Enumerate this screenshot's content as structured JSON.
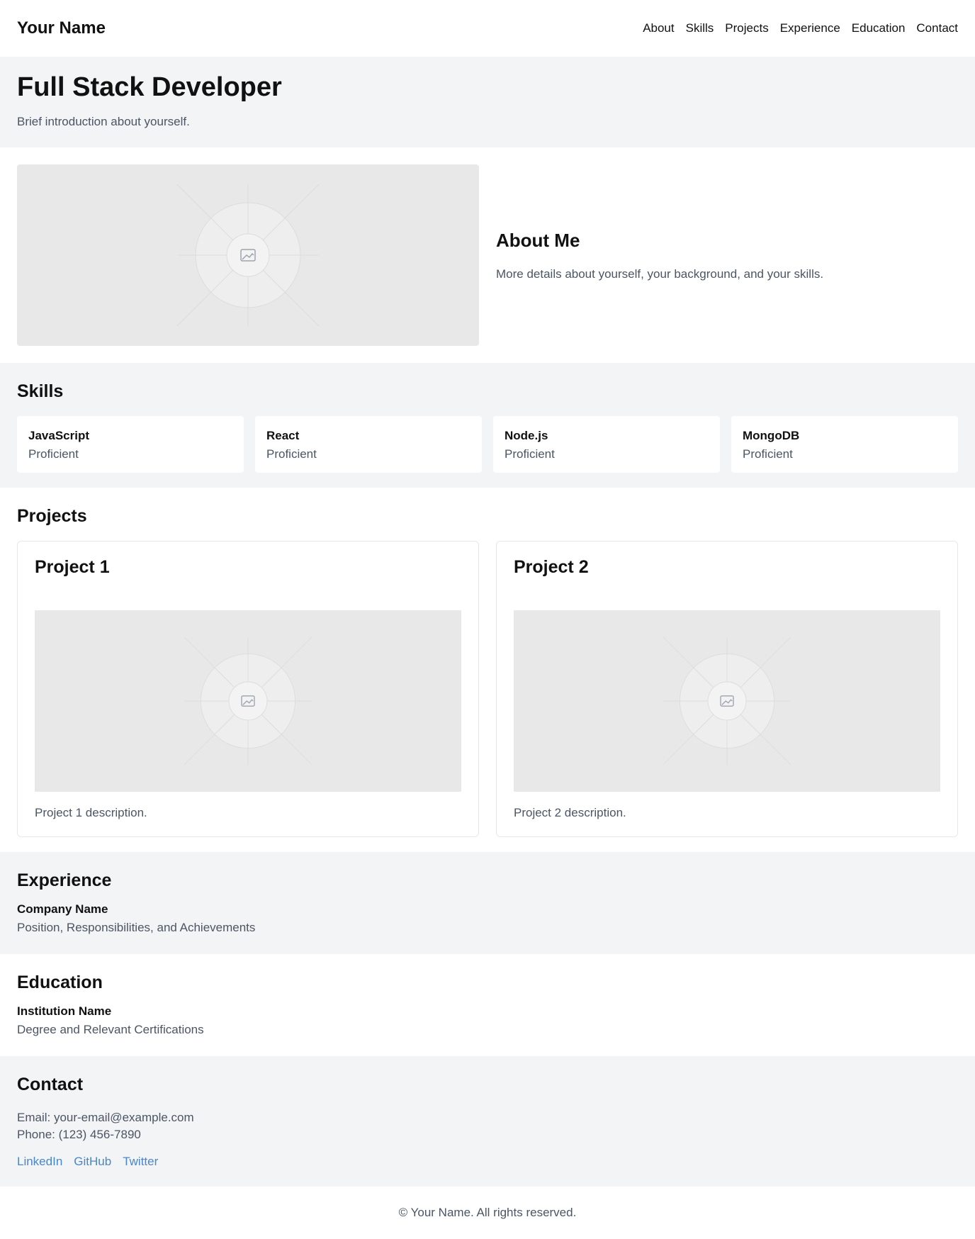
{
  "header": {
    "logo": "Your Name",
    "nav": [
      "About",
      "Skills",
      "Projects",
      "Experience",
      "Education",
      "Contact"
    ]
  },
  "hero": {
    "title": "Full Stack Developer",
    "subtitle": "Brief introduction about yourself."
  },
  "about": {
    "image_icon": "image-placeholder-icon",
    "heading": "About Me",
    "text": "More details about yourself, your background, and your skills."
  },
  "skills": {
    "heading": "Skills",
    "items": [
      {
        "name": "JavaScript",
        "level": "Proficient"
      },
      {
        "name": "React",
        "level": "Proficient"
      },
      {
        "name": "Node.js",
        "level": "Proficient"
      },
      {
        "name": "MongoDB",
        "level": "Proficient"
      }
    ]
  },
  "projects": {
    "heading": "Projects",
    "items": [
      {
        "title": "Project 1",
        "description": "Project 1 description."
      },
      {
        "title": "Project 2",
        "description": "Project 2 description."
      }
    ]
  },
  "experience": {
    "heading": "Experience",
    "company": "Company Name",
    "details": "Position, Responsibilities, and Achievements"
  },
  "education": {
    "heading": "Education",
    "institution": "Institution Name",
    "details": "Degree and Relevant Certifications"
  },
  "contact": {
    "heading": "Contact",
    "email": "Email: your-email@example.com",
    "phone": "Phone: (123) 456-7890",
    "links": [
      "LinkedIn",
      "GitHub",
      "Twitter"
    ]
  },
  "footer": {
    "text": "© Your Name. All rights reserved."
  },
  "colors": {
    "band": "#f3f4f6",
    "muted_text": "#4b5563",
    "link": "#4a86c8",
    "placeholder": "#e8e8e8"
  }
}
